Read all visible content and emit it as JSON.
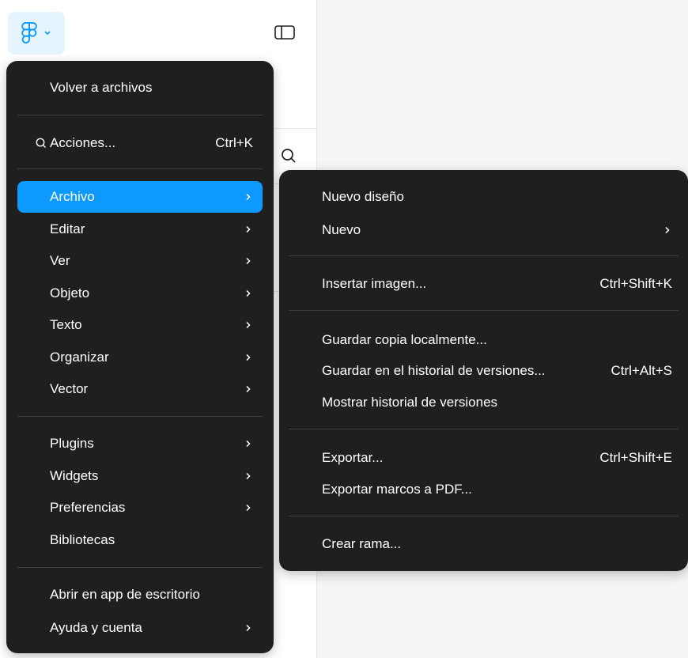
{
  "main_menu": {
    "back_to_files": "Volver a archivos",
    "actions": {
      "label": "Acciones...",
      "shortcut": "Ctrl+K"
    },
    "items": [
      {
        "label": "Archivo"
      },
      {
        "label": "Editar"
      },
      {
        "label": "Ver"
      },
      {
        "label": "Objeto"
      },
      {
        "label": "Texto"
      },
      {
        "label": "Organizar"
      },
      {
        "label": "Vector"
      },
      {
        "label": "Plugins"
      },
      {
        "label": "Widgets"
      },
      {
        "label": "Preferencias"
      },
      {
        "label": "Bibliotecas"
      },
      {
        "label": "Abrir en app de escritorio"
      },
      {
        "label": "Ayuda y cuenta"
      }
    ]
  },
  "file_submenu": {
    "items": [
      {
        "label": "Nuevo diseño",
        "shortcut": ""
      },
      {
        "label": "Nuevo",
        "shortcut": ""
      },
      {
        "label": "Insertar imagen...",
        "shortcut": "Ctrl+Shift+K"
      },
      {
        "label": "Guardar copia localmente...",
        "shortcut": ""
      },
      {
        "label": "Guardar en el historial de versiones...",
        "shortcut": "Ctrl+Alt+S"
      },
      {
        "label": "Mostrar historial de versiones",
        "shortcut": ""
      },
      {
        "label": "Exportar...",
        "shortcut": "Ctrl+Shift+E"
      },
      {
        "label": "Exportar marcos a PDF...",
        "shortcut": ""
      },
      {
        "label": "Crear rama...",
        "shortcut": ""
      }
    ]
  },
  "colors": {
    "menu_bg": "#1f1f1f",
    "highlight": "#0d99ff",
    "logo_button_bg": "#e5f4ff",
    "canvas_bg": "#f5f5f5"
  },
  "icons": {
    "logo": "figma-logo-icon",
    "logo_chevron": "chevron-down-icon",
    "sidebar": "sidebar-toggle-icon",
    "search": "search-icon",
    "submenu_arrow": "chevron-right-icon"
  }
}
